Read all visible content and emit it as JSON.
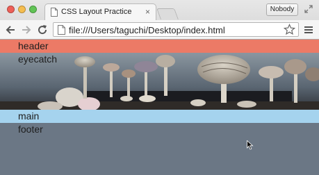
{
  "browser": {
    "tab_title": "CSS Layout Practice",
    "tab_close": "×",
    "profile_label": "Nobody",
    "url": "file:///Users/taguchi/Desktop/index.html"
  },
  "page": {
    "header_label": "header",
    "eyecatch_label": "eyecatch",
    "main_label": "main",
    "footer_label": "footer"
  },
  "colors": {
    "header_band": "#ec7a66",
    "main_band": "#a5d3ee",
    "footer_band": "#6b7785"
  },
  "icons": [
    "tab-favicon-icon",
    "fullscreen-icon",
    "back-icon",
    "forward-icon",
    "reload-icon",
    "page-icon",
    "star-icon",
    "menu-icon",
    "cursor-icon"
  ]
}
